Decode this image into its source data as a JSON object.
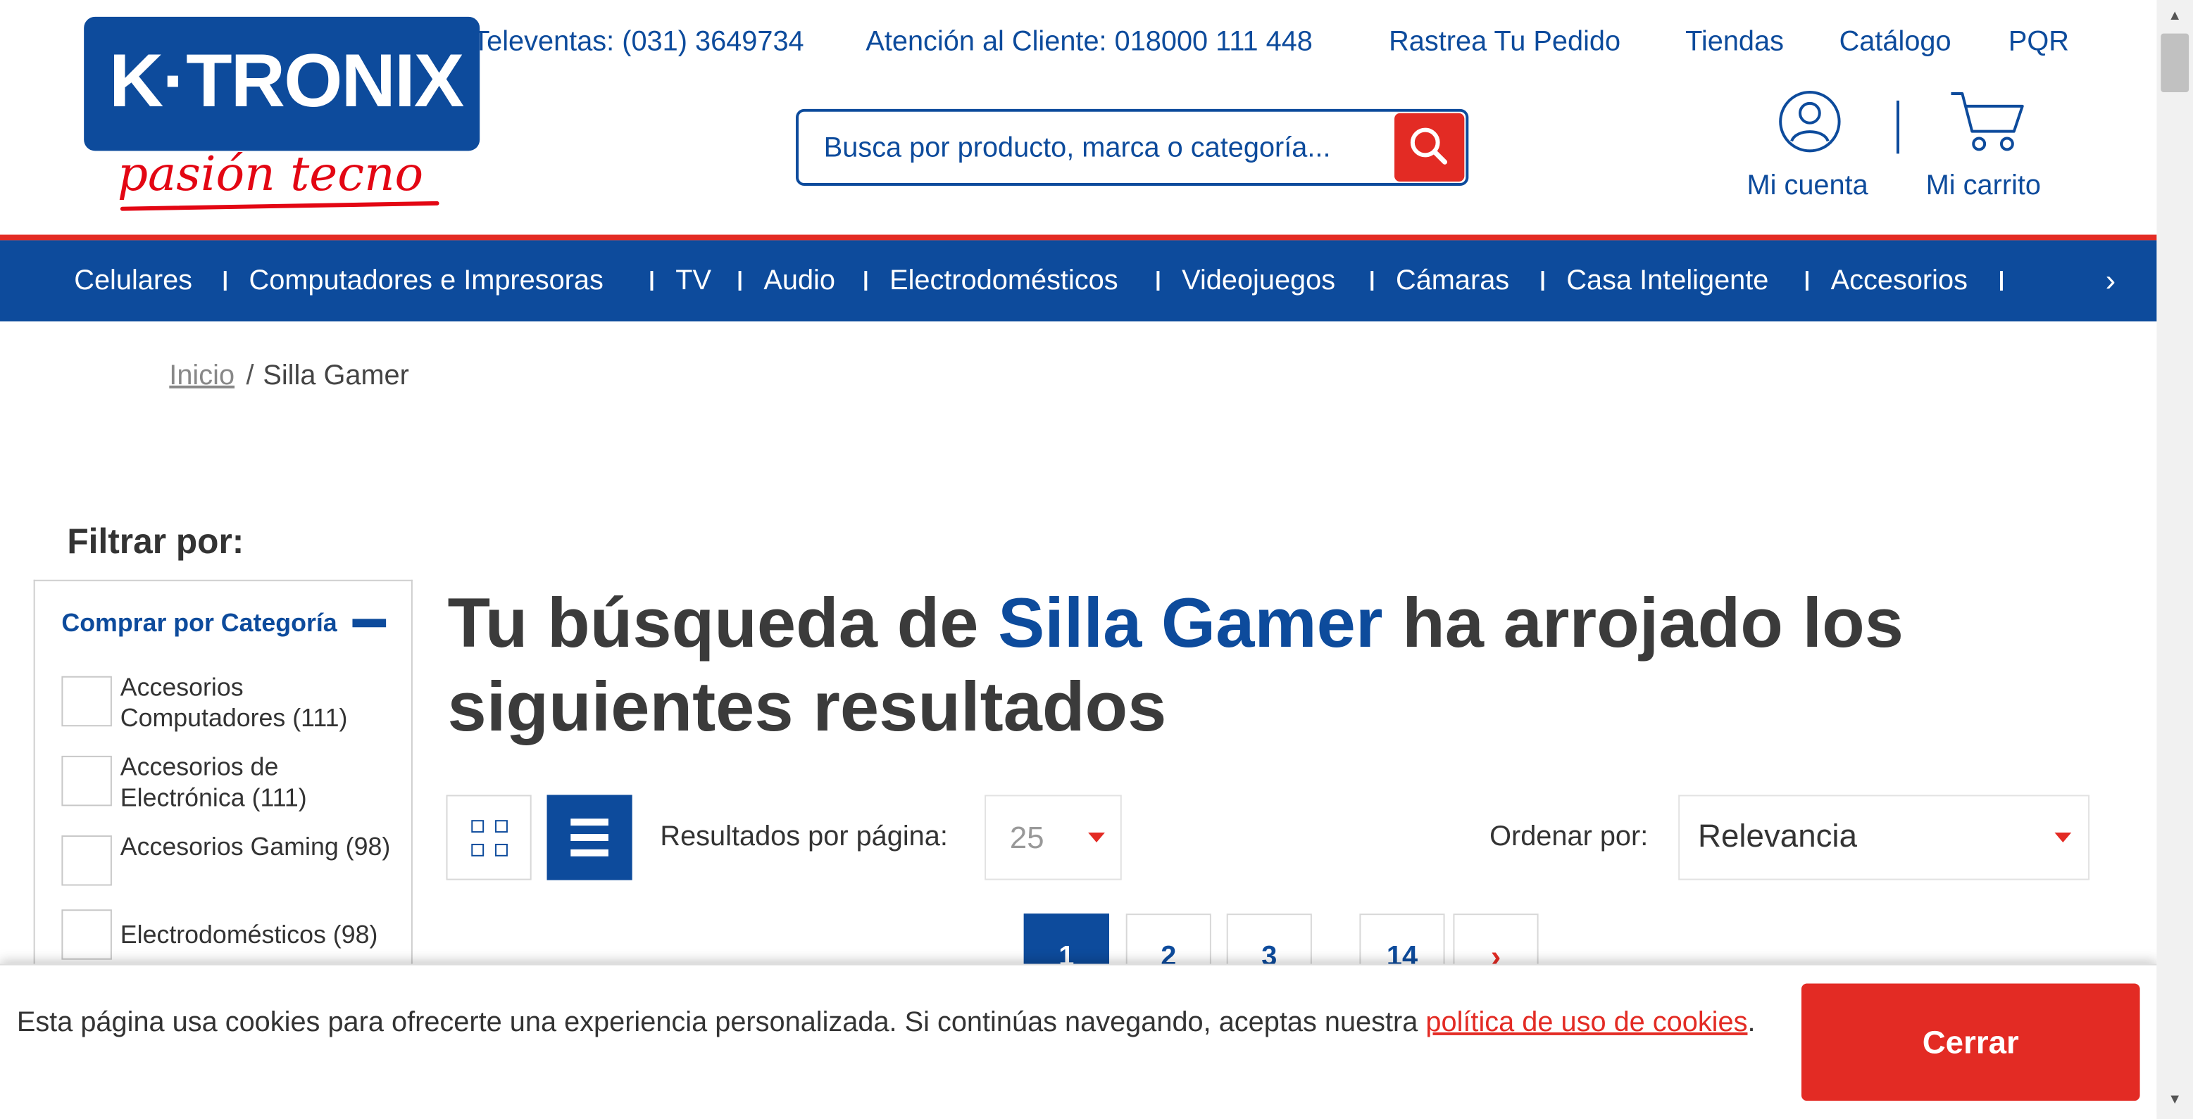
{
  "brand": {
    "name": "K·TRONIX",
    "slogan": "pasión tecno",
    "colors": {
      "primary": "#0d4b9c",
      "accent": "#e32b24"
    }
  },
  "top_links": [
    {
      "label": "Televentas: (031) 3649734"
    },
    {
      "label": "Atención al Cliente: 018000 111 448"
    },
    {
      "label": "Rastrea Tu Pedido"
    },
    {
      "label": "Tiendas"
    },
    {
      "label": "Catálogo"
    },
    {
      "label": "PQR"
    }
  ],
  "search": {
    "placeholder": "Busca por producto, marca o categoría...",
    "button_icon": "search-icon"
  },
  "account": {
    "label": "Mi cuenta",
    "icon": "user-icon"
  },
  "cart": {
    "label": "Mi carrito",
    "icon": "cart-icon"
  },
  "nav": {
    "items": [
      {
        "label": "Celulares"
      },
      {
        "label": "Computadores e Impresoras"
      },
      {
        "label": "TV"
      },
      {
        "label": "Audio"
      },
      {
        "label": "Electrodomésticos"
      },
      {
        "label": "Videojuegos"
      },
      {
        "label": "Cámaras"
      },
      {
        "label": "Casa Inteligente"
      },
      {
        "label": "Accesorios"
      }
    ],
    "more_icon": "chevron-right-icon"
  },
  "breadcrumb": {
    "home": "Inicio",
    "separator": "/",
    "current": "Silla Gamer"
  },
  "filter": {
    "title": "Filtrar por:",
    "category_title": "Comprar por Categoría",
    "options": [
      {
        "label": "Accesorios Computadores (111)"
      },
      {
        "label": "Accesorios de Electrónica (111)"
      },
      {
        "label": "Accesorios Gaming (98)"
      },
      {
        "label": "Electrodomésticos (98)"
      }
    ]
  },
  "results": {
    "heading_before": "Tu búsqueda de ",
    "search_term": "Silla Gamer",
    "heading_after": " ha arrojado los siguientes resultados"
  },
  "toolbar": {
    "per_page_label": "Resultados por página:",
    "per_page_value": "25",
    "sort_label": "Ordenar por:",
    "sort_value": "Relevancia"
  },
  "pagination": {
    "pages": [
      "1",
      "2",
      "3",
      "14"
    ],
    "current": "1",
    "next": "›"
  },
  "cookie": {
    "text": "Esta página usa cookies para ofrecerte una experiencia personalizada. Si continúas navegando, aceptas nuestra ",
    "link_text": "política de uso de cookies",
    "suffix": ".",
    "close_label": "Cerrar"
  }
}
